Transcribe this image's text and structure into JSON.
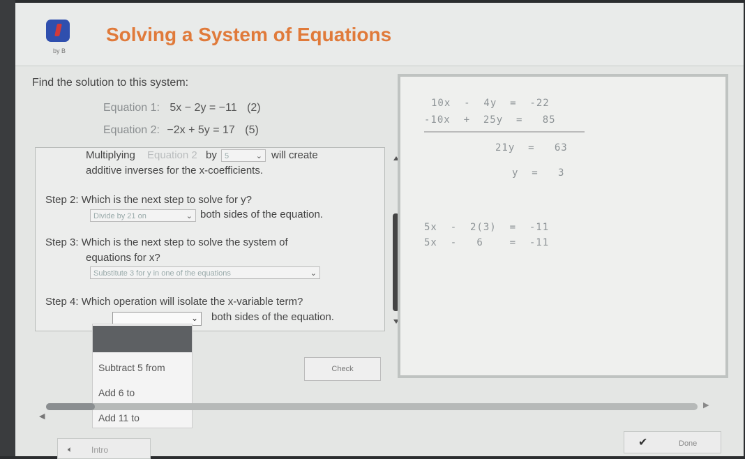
{
  "app": {
    "logo_byline": "by B",
    "title": "Solving a System of Equations"
  },
  "prompt": "Find the solution to this system:",
  "equations": [
    {
      "label": "Equation 1:",
      "expr": "5x − 2y = −11",
      "mult": "(2)"
    },
    {
      "label": "Equation 2:",
      "expr": "−2x + 5y =  17",
      "mult": "(5)"
    }
  ],
  "step1": {
    "pre": "Multiplying",
    "select1": "Equation 2",
    "mid": "by",
    "select2": "5",
    "post": "will create",
    "line2": "additive inverses for the x-coefficients."
  },
  "step2": {
    "question": "Step 2: Which is the next step to solve for y?",
    "select": "Divide by 21 on",
    "post": "both sides of the equation."
  },
  "step3": {
    "question": "Step 3: Which is the next step to solve the system of",
    "question2": "equations for x?",
    "select": "Substitute 3 for y in one of the equations"
  },
  "step4": {
    "question": "Step 4: Which operation will isolate the x-variable term?",
    "post": "both sides of the equation."
  },
  "dropdown_options": [
    "Subtract 5 from",
    "Add 6 to",
    "Add 11 to"
  ],
  "check_label": "Check",
  "work": {
    "row1": "10x  -  4y  =  -22",
    "row2": "-10x  +  25y  =   85",
    "row3": "21y  =   63",
    "row4": "y  =   3",
    "row5": "5x  -  2(3)  =  -11",
    "row6": "5x  -   6    =  -11"
  },
  "footer": {
    "intro": "Intro",
    "done": "Done"
  },
  "colors": {
    "title": "#e07a3a",
    "menu_highlight": "#5d6063",
    "background": "#e4e6e4"
  }
}
